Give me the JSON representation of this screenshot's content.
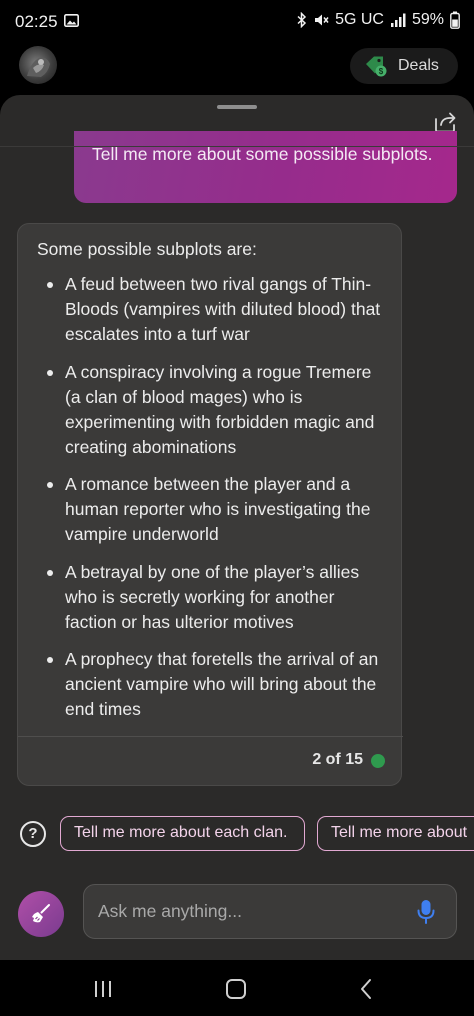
{
  "status_bar": {
    "time": "02:25",
    "network": "5G UC",
    "battery": "59%"
  },
  "header": {
    "deals_label": "Deals"
  },
  "conversation": {
    "user_message": "Tell me more about some possible subplots.",
    "bot_intro": "Some possible subplots are:",
    "subplots": [
      "A feud between two rival gangs of Thin-Bloods (vampires with diluted blood) that escalates into a turf war",
      "A conspiracy involving a rogue Tremere (a clan of blood mages) who is experimenting with forbidden magic and creating abominations",
      "A romance between the player and a human reporter who is investigating the vampire underworld",
      "A betrayal by one of the player’s allies who is secretly working for another faction or has ulterior motives",
      "A prophecy that foretells the arrival of an ancient vampire who will bring about the end times"
    ],
    "counter": "2 of 15"
  },
  "suggestions": {
    "chips": [
      "Tell me more about each clan.",
      "Tell me more about"
    ]
  },
  "composer": {
    "placeholder": "Ask me anything..."
  },
  "colors": {
    "user_bubble": "#962c8c",
    "chip_border": "#e2a9d2",
    "status_ok": "#2f9a4e",
    "mic": "#3f7ff0"
  }
}
